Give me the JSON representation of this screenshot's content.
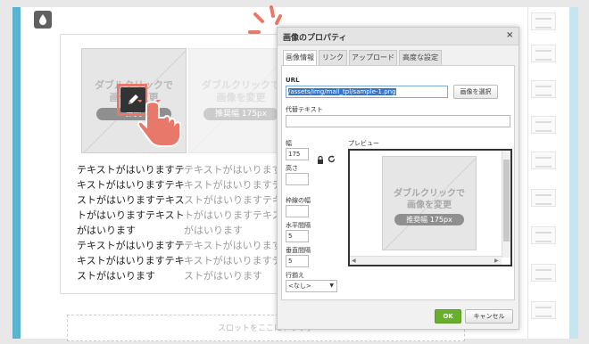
{
  "editor": {
    "drop_icon": "water-drop-icon",
    "slot_text": "スロットをここにドラッグ"
  },
  "content": {
    "image_caption_line1": "ダブルクリックで",
    "image_caption_line2": "画像を変更",
    "image_size_badge": "推奨幅 175px",
    "image_size_badge_partial": "推奨",
    "paragraph": "テキストがはいりますテキストがはいりますテキストがはいりますテキストがはいりますがはいりますテキストがはいりますテキストがはいりますテキストがはいります",
    "paragraph_lines": [
      "テキストがはいりますテ",
      "キストがはいりますテキ",
      "ストがはいりますテキス",
      "トがはいりますテキスト",
      "がはいります",
      "テキストがはいりますテ",
      "キストがはいりますテキ",
      "ストがはいります"
    ]
  },
  "dialog": {
    "title": "画像のプロパティ",
    "close_label": "×",
    "tabs": [
      {
        "label": "画像情報",
        "active": true
      },
      {
        "label": "リンク",
        "active": false
      },
      {
        "label": "アップロード",
        "active": false
      },
      {
        "label": "高度な設定",
        "active": false
      }
    ],
    "url_label": "URL",
    "url_value": "/assets/img/mail_tpl/sample-1.png",
    "select_image_button": "画像を選択",
    "alt_label": "代替テキスト",
    "alt_value": "",
    "width_label": "幅",
    "width_value": "175",
    "height_label": "高さ",
    "height_value": "",
    "lock_icon": "lock-icon",
    "reset_icon": "reset-size-icon",
    "border_label": "枠線の幅",
    "border_value": "",
    "hspace_label": "水平間隔",
    "hspace_value": "5",
    "vspace_label": "垂直間隔",
    "vspace_value": "5",
    "align_label": "行揃え",
    "align_value": "<なし>",
    "preview_label": "プレビュー",
    "ok_button": "OK",
    "cancel_button": "キャンセル"
  },
  "colors": {
    "left_bar": "#5ab4cf",
    "accent_highlight": "#e8786a",
    "ok_green": "#6aae2e",
    "url_selection": "#3676c9"
  }
}
